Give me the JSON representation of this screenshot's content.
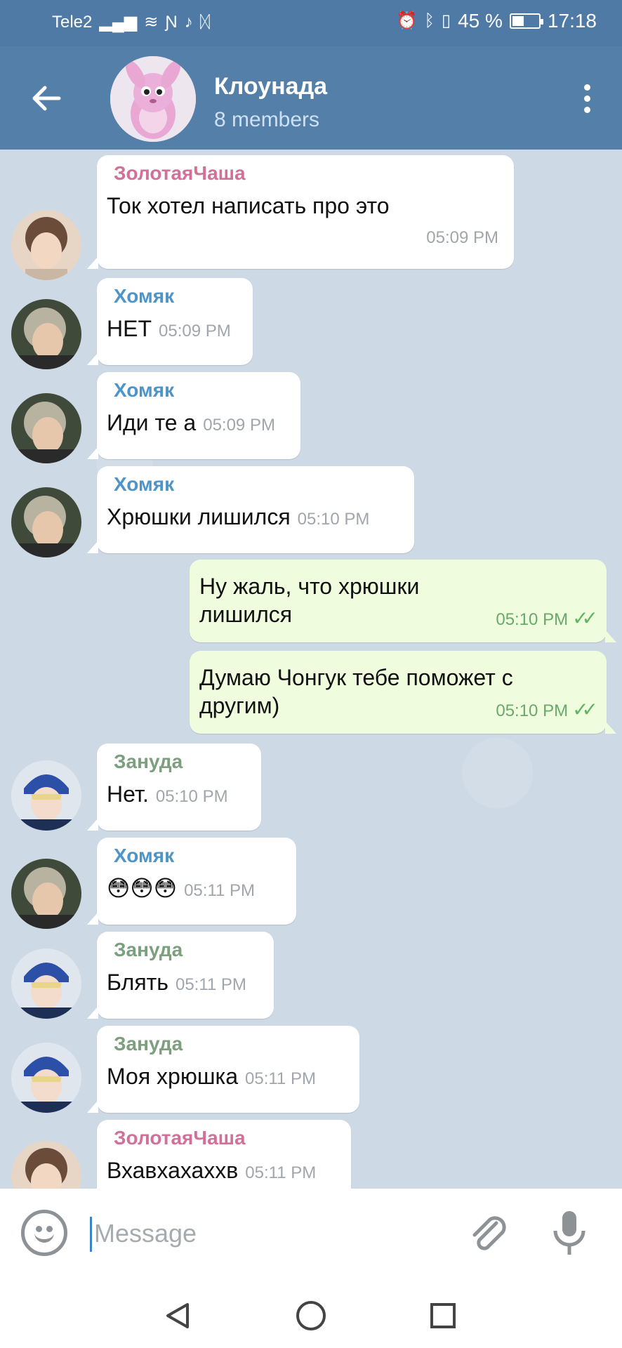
{
  "status_bar": {
    "carrier": "Tele2",
    "battery": "45 %",
    "battery_level": 0.45,
    "time": "17:18"
  },
  "header": {
    "title": "Клоунада",
    "subtitle": "8 members"
  },
  "messages": [
    {
      "sender": "ЗолотаяЧаша",
      "text": "Ток хотел написать про это",
      "time": "05:09 PM"
    },
    {
      "sender": "Хомяк",
      "text": "НЕТ",
      "time": "05:09 PM"
    },
    {
      "sender": "Хомяк",
      "text": "Иди те а",
      "time": "05:09 PM"
    },
    {
      "sender": "Хомяк",
      "text": "Хрюшки лишился",
      "time": "05:10 PM"
    },
    {
      "sender": "",
      "text": "Ну жаль, что хрюшки лишился",
      "time": "05:10 PM"
    },
    {
      "sender": "",
      "text": "Думаю Чонгук тебе поможет с другим)",
      "time": "05:10 PM"
    },
    {
      "sender": "Зануда",
      "text": "Нет.",
      "time": "05:10 PM"
    },
    {
      "sender": "Хомяк",
      "text": "😳😳😳",
      "time": "05:11 PM"
    },
    {
      "sender": "Зануда",
      "text": "Блять",
      "time": "05:11 PM"
    },
    {
      "sender": "Зануда",
      "text": "Моя хрюшка",
      "time": "05:11 PM"
    },
    {
      "sender": "ЗолотаяЧаша",
      "text": "Вхавхахаххв",
      "time": "05:11 PM"
    }
  ],
  "input": {
    "placeholder": "Message"
  },
  "colors": {
    "header": "#537fa9",
    "sender_zolotaya": "#d2709a",
    "sender_khomyak": "#4d95c8",
    "sender_zanuda": "#7c9f7d",
    "outgoing_bubble": "#effdde"
  }
}
